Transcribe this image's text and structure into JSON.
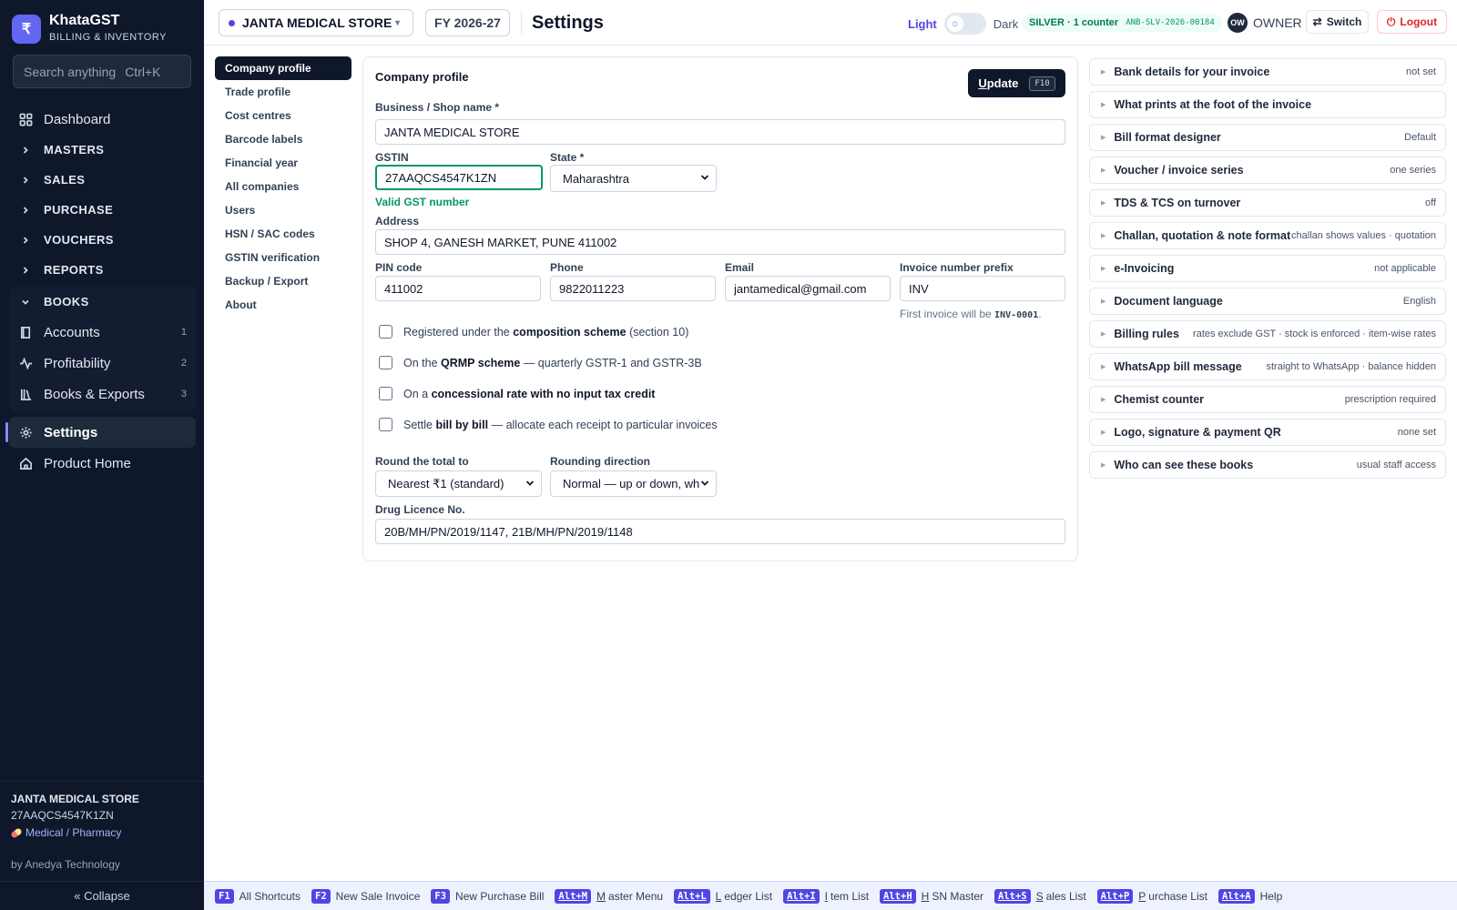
{
  "brand": {
    "logo_glyph": "₹",
    "title": "KhataGST",
    "subtitle": "BILLING & INVENTORY"
  },
  "search": {
    "placeholder": "Search anything",
    "shortcut": "Ctrl+K"
  },
  "nav": {
    "dashboard": "Dashboard",
    "groups": [
      "MASTERS",
      "SALES",
      "PURCHASE",
      "VOUCHERS",
      "REPORTS"
    ],
    "books": {
      "label": "BOOKS",
      "items": [
        {
          "label": "Accounts",
          "badge": "1",
          "icon": "book-icon"
        },
        {
          "label": "Profitability",
          "badge": "2",
          "icon": "activity-icon"
        },
        {
          "label": "Books & Exports",
          "badge": "3",
          "icon": "library-icon"
        }
      ]
    },
    "settings": "Settings",
    "product_home": "Product Home"
  },
  "sidebar_footer": {
    "company": "JANTA MEDICAL STORE",
    "gstin": "27AAQCS4547K1ZN",
    "business_type": "Medical / Pharmacy",
    "by": "by Anedya Technology",
    "collapse": "« Collapse"
  },
  "topbar": {
    "company": "JANTA MEDICAL STORE",
    "fy": "FY 2026-27",
    "title": "Settings",
    "theme": {
      "light": "Light",
      "dark": "Dark",
      "mode": "light"
    },
    "plan": "SILVER · 1 counter",
    "license": "ANB-SLV-2026-00184",
    "avatar": "OW",
    "role": "OWNER",
    "switch": "Switch",
    "logout": "Logout"
  },
  "settings_nav": [
    "Company profile",
    "Trade profile",
    "Cost centres",
    "Barcode labels",
    "Financial year",
    "All companies",
    "Users",
    "HSN / SAC codes",
    "GSTIN verification",
    "Backup / Export",
    "About"
  ],
  "settings_nav_active": "Company profile",
  "form": {
    "title": "Company profile",
    "update": {
      "label_u": "U",
      "label_rest": "pdate",
      "key": "F10"
    },
    "business_name": {
      "label": "Business / Shop name *",
      "value": "JANTA MEDICAL STORE"
    },
    "gstin": {
      "label": "GSTIN",
      "value": "27AAQCS4547K1ZN",
      "status": "Valid GST number"
    },
    "state": {
      "label": "State *",
      "value": "Maharashtra"
    },
    "address": {
      "label": "Address",
      "value": "SHOP 4, GANESH MARKET, PUNE 411002"
    },
    "pin": {
      "label": "PIN code",
      "value": "411002"
    },
    "phone": {
      "label": "Phone",
      "value": "9822011223"
    },
    "email": {
      "label": "Email",
      "value": "jantamedical@gmail.com"
    },
    "prefix": {
      "label": "Invoice number prefix",
      "value": "INV",
      "hint_pre": "First invoice will be",
      "hint_code": "INV-0001",
      "hint_post": "."
    },
    "checkboxes": [
      {
        "pre": "Registered under the",
        "bold": "composition scheme",
        "post": "(section 10)",
        "checked": false
      },
      {
        "pre": "On the",
        "bold": "QRMP scheme",
        "post": "— quarterly GSTR-1 and GSTR-3B",
        "checked": false
      },
      {
        "pre": "On a",
        "bold": "concessional rate with no input tax credit",
        "post": "",
        "checked": false
      },
      {
        "pre": "Settle",
        "bold": "bill by bill",
        "post": "— allocate each receipt to particular invoices",
        "checked": false
      }
    ],
    "round_total": {
      "label": "Round the total to",
      "value": "Nearest ₹1 (standard)"
    },
    "rounding_direction": {
      "label": "Rounding direction",
      "value": "Normal — up or down, wh"
    },
    "drug_licence": {
      "label": "Drug Licence No.",
      "value": "20B/MH/PN/2019/1147, 21B/MH/PN/2019/1148"
    }
  },
  "accordion": [
    {
      "title": "Bank details for your invoice",
      "summary": "not set"
    },
    {
      "title": "What prints at the foot of the invoice",
      "summary": ""
    },
    {
      "title": "Bill format designer",
      "summary": "Default"
    },
    {
      "title": "Voucher / invoice series",
      "summary": "one series"
    },
    {
      "title": "TDS & TCS on turnover",
      "summary": "off"
    },
    {
      "title": "Challan, quotation & note format",
      "summary": "challan shows values · quotation"
    },
    {
      "title": "e-Invoicing",
      "summary": "not applicable"
    },
    {
      "title": "Document language",
      "summary": "English"
    },
    {
      "title": "Billing rules",
      "summary": "rates exclude GST · stock is enforced · item-wise rates"
    },
    {
      "title": "WhatsApp bill message",
      "summary": "straight to WhatsApp · balance hidden"
    },
    {
      "title": "Chemist counter",
      "summary": "prescription required"
    },
    {
      "title": "Logo, signature & payment QR",
      "summary": "none set"
    },
    {
      "title": "Who can see these books",
      "summary": "usual staff access"
    }
  ],
  "shortcuts": [
    {
      "key": "F1",
      "mn": "",
      "label": "All Shortcuts"
    },
    {
      "key": "F2",
      "mn": "",
      "label": "New Sale Invoice"
    },
    {
      "key": "F3",
      "mn": "",
      "label": "New Purchase Bill"
    },
    {
      "key": "Alt+M",
      "mn": "M",
      "label": "aster Menu"
    },
    {
      "key": "Alt+L",
      "mn": "L",
      "label": "edger List"
    },
    {
      "key": "Alt+I",
      "mn": "I",
      "label": "tem List"
    },
    {
      "key": "Alt+H",
      "mn": "H",
      "label": "SN Master"
    },
    {
      "key": "Alt+S",
      "mn": "S",
      "label": "ales List"
    },
    {
      "key": "Alt+P",
      "mn": "P",
      "label": "urchase List"
    },
    {
      "key": "Alt+A",
      "mn": "",
      "label": "Help"
    }
  ],
  "colors": {
    "accent": "#4f46e5",
    "sidebar_bg": "#0f172a",
    "valid": "#059669",
    "danger": "#dc2626"
  }
}
